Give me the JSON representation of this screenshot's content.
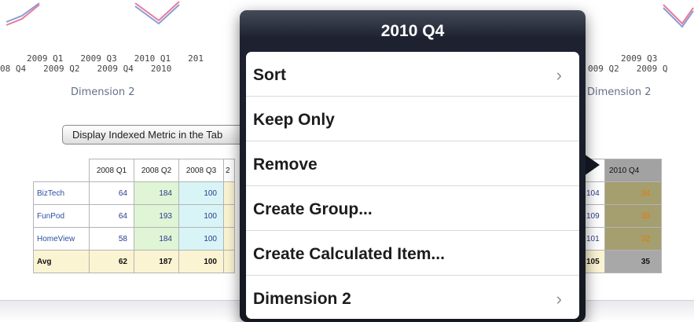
{
  "axis_left": {
    "top_row": [
      "2009 Q1",
      "2009 Q3",
      "2010 Q1",
      "201"
    ],
    "bottom_row": [
      "08 Q4",
      "2009 Q2",
      "2009 Q4",
      "2010"
    ]
  },
  "axis_right": {
    "top_row": [
      "2009 Q3"
    ],
    "bottom_row": [
      "009 Q2",
      "2009 Q"
    ]
  },
  "dimension_left": "Dimension 2",
  "dimension_right": "Dimension 2",
  "indexed_button_label": "Display Indexed Metric in the Tab",
  "left_table": {
    "headers": [
      "2008 Q1",
      "2008 Q2",
      "2008 Q3",
      "2"
    ],
    "rows": [
      {
        "label": "BizTech",
        "values": [
          "64",
          "184",
          "100",
          ""
        ]
      },
      {
        "label": "FunPod",
        "values": [
          "64",
          "193",
          "100",
          ""
        ]
      },
      {
        "label": "HomeView",
        "values": [
          "58",
          "184",
          "100",
          ""
        ]
      },
      {
        "label": "Avg",
        "values": [
          "62",
          "187",
          "100",
          ""
        ]
      }
    ]
  },
  "right_table": {
    "headers": [
      "",
      "2010 Q4"
    ],
    "rows": [
      {
        "a": "104",
        "b": "34"
      },
      {
        "a": "109",
        "b": "39"
      },
      {
        "a": "101",
        "b": "32"
      },
      {
        "a": "105",
        "b": "35"
      }
    ]
  },
  "popover": {
    "title": "2010 Q4",
    "items": [
      {
        "label": "Sort",
        "chevron": "›"
      },
      {
        "label": "Keep Only",
        "chevron": ""
      },
      {
        "label": "Remove",
        "chevron": ""
      },
      {
        "label": "Create Group...",
        "chevron": ""
      },
      {
        "label": "Create Calculated Item...",
        "chevron": ""
      },
      {
        "label": "Dimension 2",
        "chevron": "›"
      }
    ]
  },
  "colors": {
    "sparkline_blue": "#8a9bd6",
    "sparkline_pink": "#e87a9a",
    "popover_dark": "#141821",
    "highlight_column": "#a59e6e",
    "orange_value": "#e87a00"
  }
}
